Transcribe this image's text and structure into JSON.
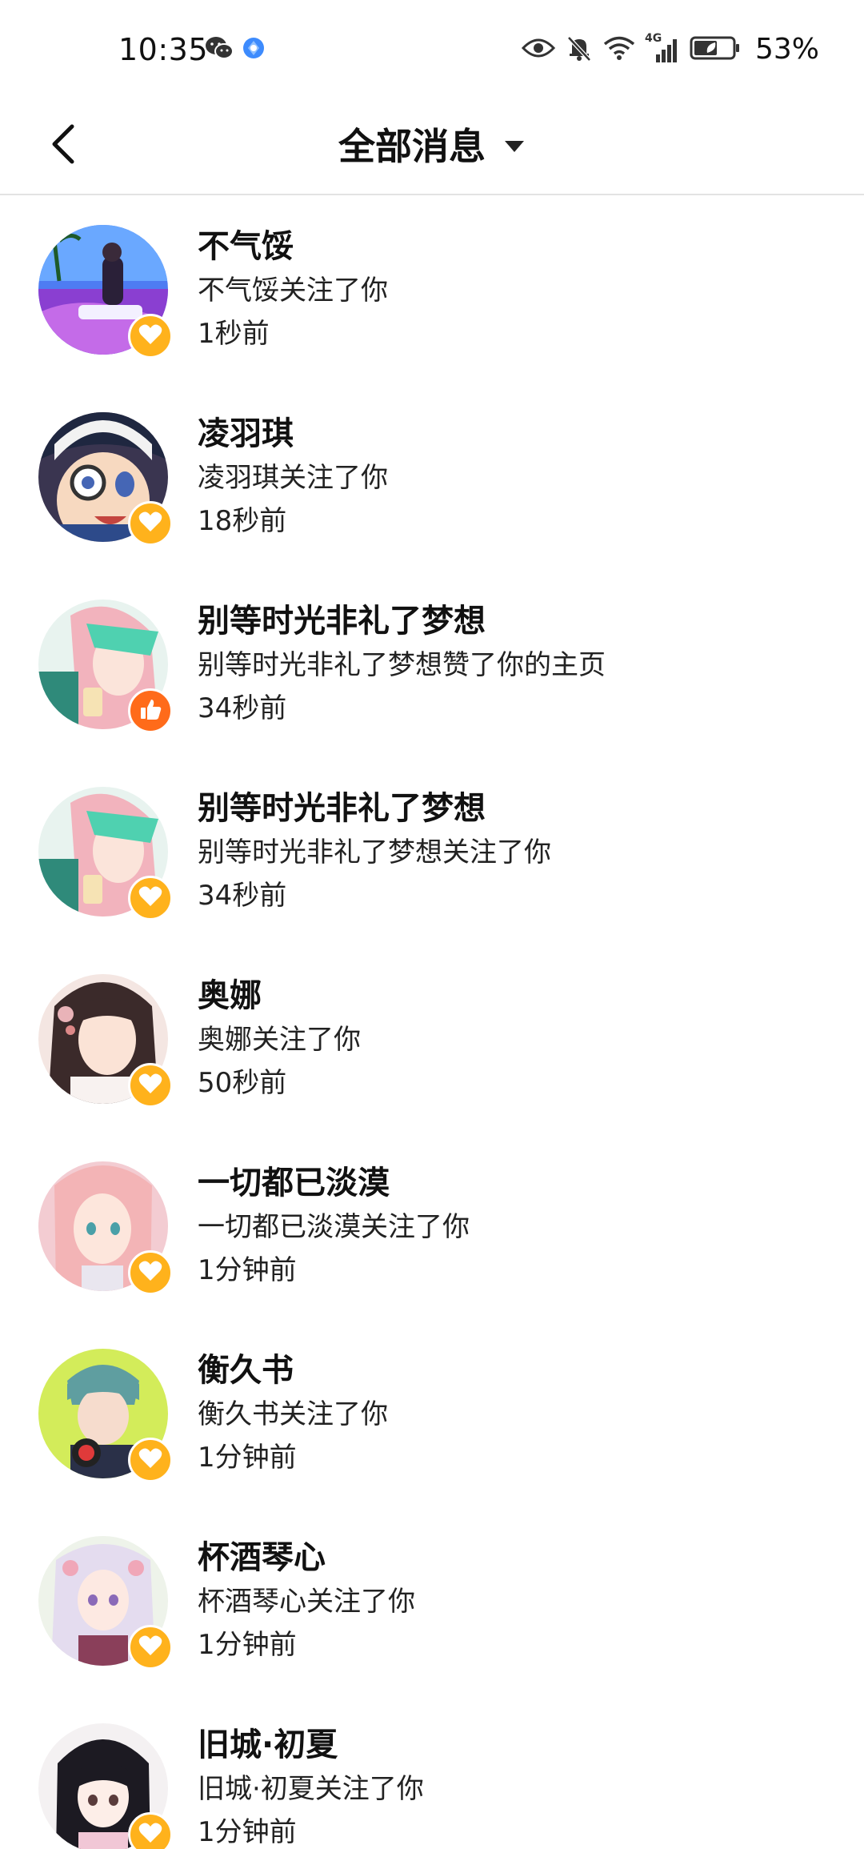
{
  "status_bar": {
    "time": "10:35",
    "battery_percent": "53%",
    "network_label": "4G",
    "icons": [
      "wechat-icon",
      "browser-icon",
      "eye-icon",
      "bell-muted-icon",
      "wifi-icon",
      "cellular-signal-icon",
      "battery-icon"
    ]
  },
  "header": {
    "title": "全部消息",
    "back_icon": "chevron-left-icon",
    "dropdown_icon": "caret-down-icon"
  },
  "colors": {
    "follow_badge": "#ffb21c",
    "like_badge": "#ff6b1a",
    "divider": "#e3e3e3"
  },
  "messages": [
    {
      "name": "不气馁",
      "action": "不气馁关注了你",
      "time": "1秒前",
      "badge": "heart-icon",
      "type": "follow"
    },
    {
      "name": "凌羽琪",
      "action": "凌羽琪关注了你",
      "time": "18秒前",
      "badge": "heart-icon",
      "type": "follow"
    },
    {
      "name": "别等时光非礼了梦想",
      "action": "别等时光非礼了梦想赞了你的主页",
      "time": "34秒前",
      "badge": "thumbs-up-icon",
      "type": "like"
    },
    {
      "name": "别等时光非礼了梦想",
      "action": "别等时光非礼了梦想关注了你",
      "time": "34秒前",
      "badge": "heart-icon",
      "type": "follow"
    },
    {
      "name": "奥娜",
      "action": "奥娜关注了你",
      "time": "50秒前",
      "badge": "heart-icon",
      "type": "follow"
    },
    {
      "name": "一切都已淡漠",
      "action": "一切都已淡漠关注了你",
      "time": "1分钟前",
      "badge": "heart-icon",
      "type": "follow"
    },
    {
      "name": "衡久书",
      "action": "衡久书关注了你",
      "time": "1分钟前",
      "badge": "heart-icon",
      "type": "follow"
    },
    {
      "name": "杯酒琴心",
      "action": "杯酒琴心关注了你",
      "time": "1分钟前",
      "badge": "heart-icon",
      "type": "follow"
    },
    {
      "name": "旧城·初夏",
      "action": "旧城·初夏关注了你",
      "time": "1分钟前",
      "badge": "heart-icon",
      "type": "follow"
    }
  ]
}
